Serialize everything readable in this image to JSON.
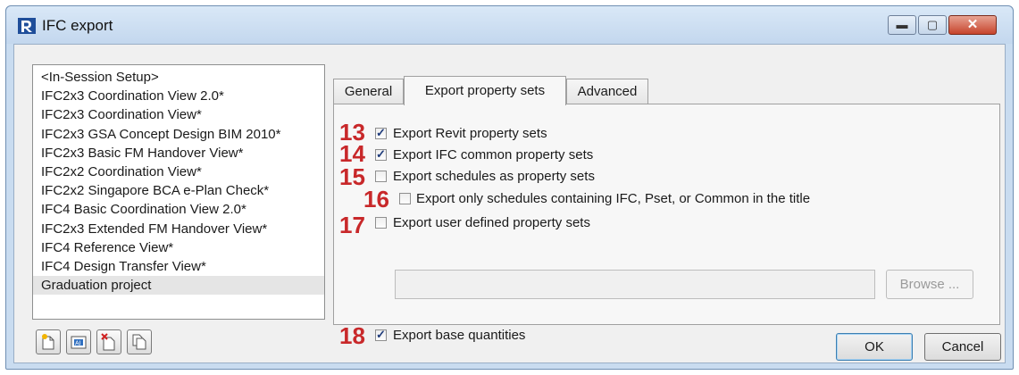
{
  "window": {
    "title": "IFC export",
    "min_glyph": "▬",
    "max_glyph": "▢",
    "close_glyph": "✕"
  },
  "setups": [
    "<In-Session Setup>",
    "IFC2x3 Coordination View 2.0*",
    "IFC2x3 Coordination View*",
    "IFC2x3 GSA Concept Design BIM 2010*",
    "IFC2x3 Basic FM Handover View*",
    "IFC2x2 Coordination View*",
    "IFC2x2 Singapore BCA e-Plan Check*",
    "IFC4 Basic Coordination View 2.0*",
    "IFC2x3 Extended FM Handover View*",
    "IFC4 Reference View*",
    "IFC4 Design Transfer View*",
    "Graduation project"
  ],
  "selected_setup": "Graduation project",
  "tabs": [
    {
      "label": "General",
      "active": false
    },
    {
      "label": "Export property sets",
      "active": true
    },
    {
      "label": "Advanced",
      "active": false
    }
  ],
  "options": [
    {
      "number": "13",
      "label": "Export Revit property sets",
      "checked": true
    },
    {
      "number": "14",
      "label": "Export IFC common property sets",
      "checked": true
    },
    {
      "number": "15",
      "label": "Export schedules as property sets",
      "checked": false
    },
    {
      "number": "16",
      "label": "Export only schedules containing IFC, Pset, or Common in the title",
      "checked": false
    },
    {
      "number": "17",
      "label": "Export user defined property sets",
      "checked": false
    },
    {
      "number": "18",
      "label": "Export base quantities",
      "checked": true
    }
  ],
  "user_defined_path": {
    "value": ""
  },
  "browse_label": "Browse ...",
  "ok_label": "OK",
  "cancel_label": "Cancel",
  "icons": [
    "new-setup-icon",
    "rename-setup-icon",
    "delete-setup-icon",
    "duplicate-setup-icon"
  ],
  "colors": {
    "number_red": "#c8282a",
    "title_bar": "#c9dcf0",
    "check_mark": "#1d3a7a"
  }
}
